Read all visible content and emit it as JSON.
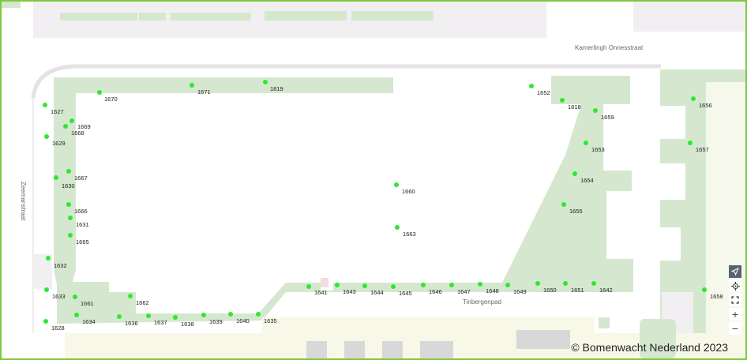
{
  "streets": {
    "kamerlingh": "Kamerlingh Onnesstraat",
    "zeeman": "Zeemanstraat",
    "tinbergen": "Tinbergenpad"
  },
  "attribution": "©  Bomenwacht Nederland 2023",
  "controls": {
    "navigate_icon": "arrow-navigation-icon",
    "locate_icon": "crosshair-icon",
    "fullscreen_icon": "fullscreen-icon",
    "zoom_in": "+",
    "zoom_out": "−"
  },
  "colors": {
    "tree": "#2fe82f",
    "green_area": "#d5e8cf",
    "building": "#f1eff1",
    "frame": "#7dc93e"
  },
  "trees": [
    {
      "id": "1670"
    },
    {
      "id": "1671"
    },
    {
      "id": "1819"
    },
    {
      "id": "1627"
    },
    {
      "id": "1669"
    },
    {
      "id": "1668"
    },
    {
      "id": "1629"
    },
    {
      "id": "1667"
    },
    {
      "id": "1630"
    },
    {
      "id": "1666"
    },
    {
      "id": "1631"
    },
    {
      "id": "1665"
    },
    {
      "id": "1632"
    },
    {
      "id": "1633"
    },
    {
      "id": "1661"
    },
    {
      "id": "1662"
    },
    {
      "id": "1634"
    },
    {
      "id": "1628"
    },
    {
      "id": "1636"
    },
    {
      "id": "1637"
    },
    {
      "id": "1638"
    },
    {
      "id": "1639"
    },
    {
      "id": "1640"
    },
    {
      "id": "1635"
    },
    {
      "id": "1641"
    },
    {
      "id": "1643"
    },
    {
      "id": "1644"
    },
    {
      "id": "1645"
    },
    {
      "id": "1646"
    },
    {
      "id": "1647"
    },
    {
      "id": "1648"
    },
    {
      "id": "1649"
    },
    {
      "id": "1650"
    },
    {
      "id": "1651"
    },
    {
      "id": "1642"
    },
    {
      "id": "1660"
    },
    {
      "id": "1663"
    },
    {
      "id": "1652"
    },
    {
      "id": "1818"
    },
    {
      "id": "1659"
    },
    {
      "id": "1653"
    },
    {
      "id": "1654"
    },
    {
      "id": "1655"
    },
    {
      "id": "1656"
    },
    {
      "id": "1657"
    },
    {
      "id": "1658"
    }
  ]
}
